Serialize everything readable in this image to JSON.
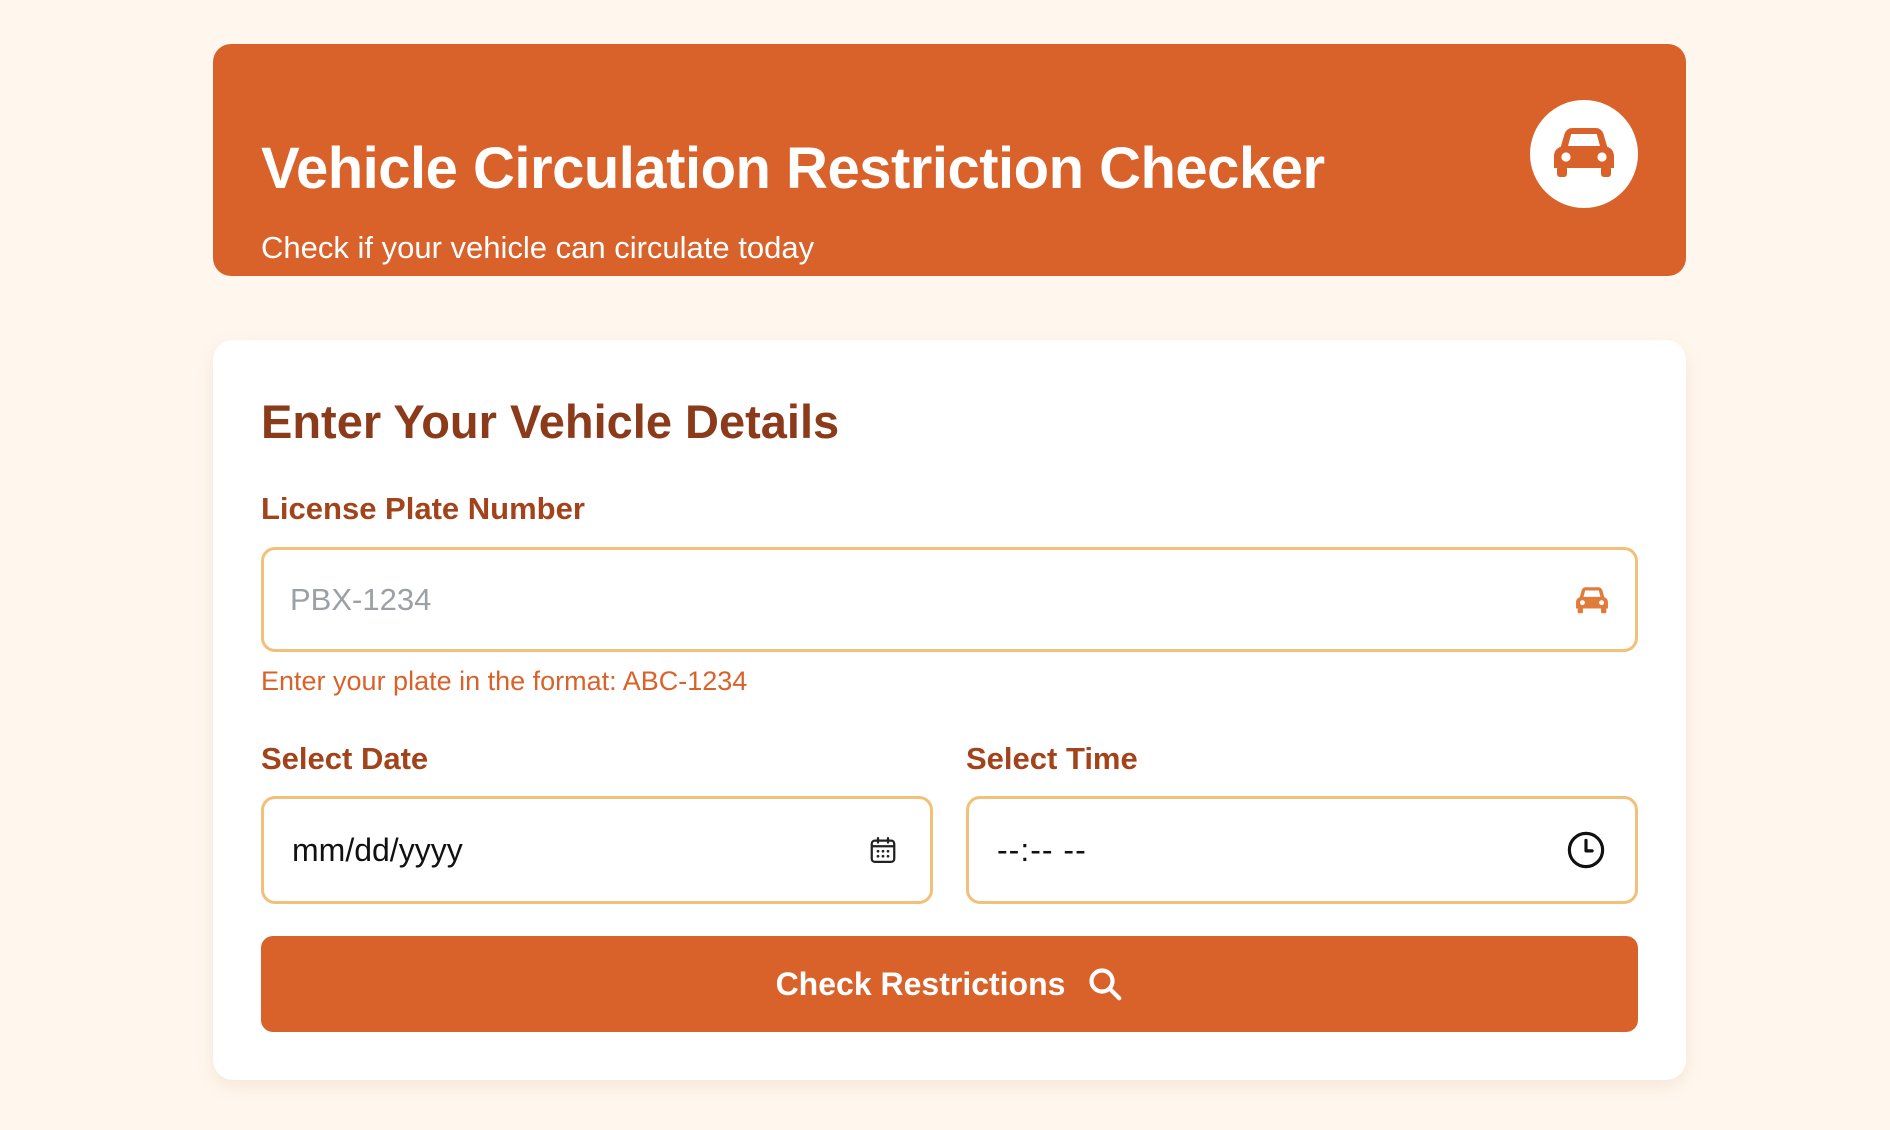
{
  "colors": {
    "page_background": "#fff7ee",
    "accent": "#d9622b",
    "heading": "#8b3a1a",
    "label": "#a2431c",
    "input_border": "#f2c079",
    "placeholder": "#9aa0a6"
  },
  "header": {
    "title": "Vehicle Circulation Restriction Checker",
    "subtitle": "Check if your vehicle can circulate today",
    "icon": "car-icon"
  },
  "form": {
    "title": "Enter Your Vehicle Details",
    "plate": {
      "label": "License Plate Number",
      "placeholder": "PBX-1234",
      "value": "",
      "hint": "Enter your plate in the format: ABC-1234",
      "icon": "car-icon"
    },
    "date": {
      "label": "Select Date",
      "display": "mm/dd/yyyy",
      "icon": "calendar-icon"
    },
    "time": {
      "label": "Select Time",
      "display": "--:-- --",
      "icon": "clock-icon"
    },
    "submit": {
      "label": "Check Restrictions",
      "icon": "search-icon"
    }
  }
}
